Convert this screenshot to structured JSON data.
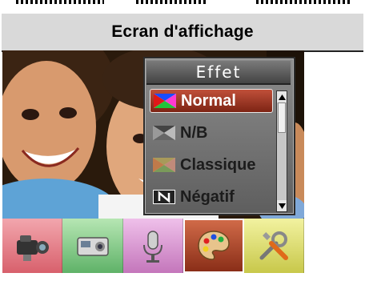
{
  "header": {
    "title": "Ecran d'affichage"
  },
  "effect_menu": {
    "title": "Effet",
    "items": [
      {
        "label": "Normal",
        "icon": "normal-effect-icon",
        "selected": true
      },
      {
        "label": "N/B",
        "icon": "bw-effect-icon",
        "selected": false
      },
      {
        "label": "Classique",
        "icon": "classic-effect-icon",
        "selected": false
      },
      {
        "label": "Négatif",
        "icon": "negative-effect-icon",
        "selected": false
      }
    ]
  },
  "toolbar": {
    "tabs": [
      {
        "icon": "video-camera-icon",
        "color": "#e0707a"
      },
      {
        "icon": "camera-icon",
        "color": "#6fbf73"
      },
      {
        "icon": "microphone-icon",
        "color": "#d487c8"
      },
      {
        "icon": "palette-icon",
        "color": "#b5482c",
        "active": true
      },
      {
        "icon": "tools-icon",
        "color": "#e2e26a"
      }
    ]
  },
  "colors": {
    "selected_item": "#a33a25",
    "header_bg": "#d9d9d9"
  }
}
